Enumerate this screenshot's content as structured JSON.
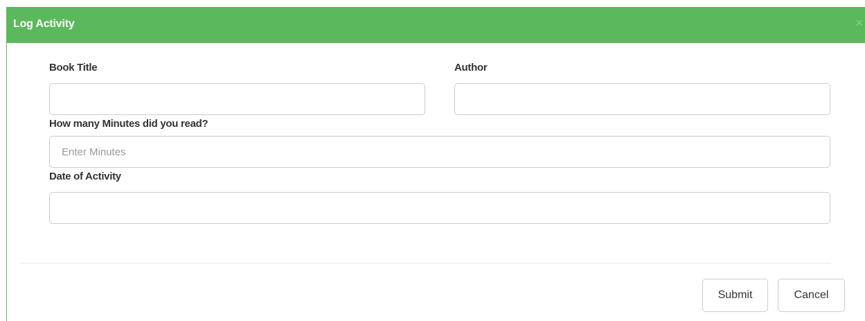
{
  "modal": {
    "title": "Log Activity",
    "close_symbol": "×",
    "close_icon": "close-icon",
    "header_color": "#5cb85c"
  },
  "form": {
    "book_title": {
      "label": "Book Title",
      "value": ""
    },
    "author": {
      "label": "Author",
      "value": ""
    },
    "minutes": {
      "label": "How many Minutes did you read?",
      "placeholder": "Enter Minutes",
      "value": ""
    },
    "date": {
      "label": "Date of Activity",
      "value": ""
    }
  },
  "footer": {
    "submit_label": "Submit",
    "cancel_label": "Cancel"
  }
}
